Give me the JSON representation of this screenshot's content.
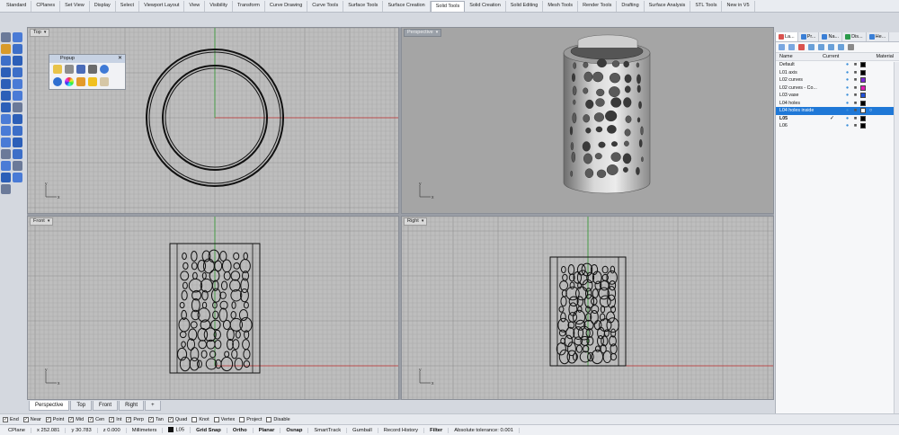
{
  "tabs": [
    "Standard",
    "CPlanes",
    "Set View",
    "Display",
    "Select",
    "Viewport Layout",
    "View",
    "Visibility",
    "Transform",
    "Curve Drawing",
    "Curve Tools",
    "Surface Tools",
    "Surface Creation",
    "Solid Tools",
    "Solid Creation",
    "Solid Editing",
    "Mesh Tools",
    "Render Tools",
    "Drafting",
    "Surface Analysis",
    "STL Tools",
    "New in V5"
  ],
  "active_tab_index": 13,
  "viewports": {
    "top": {
      "title": "Top"
    },
    "perspective": {
      "title": "Perspective"
    },
    "front": {
      "title": "Front"
    },
    "right": {
      "title": "Right"
    }
  },
  "popup": {
    "title": "Popup"
  },
  "viewport_tabs": [
    "Perspective",
    "Top",
    "Front",
    "Right"
  ],
  "osnaps": [
    {
      "label": "End",
      "checked": true
    },
    {
      "label": "Near",
      "checked": true
    },
    {
      "label": "Point",
      "checked": true
    },
    {
      "label": "Mid",
      "checked": true
    },
    {
      "label": "Cen",
      "checked": true
    },
    {
      "label": "Int",
      "checked": true
    },
    {
      "label": "Perp",
      "checked": true
    },
    {
      "label": "Tan",
      "checked": true
    },
    {
      "label": "Quad",
      "checked": true
    },
    {
      "label": "Knot",
      "checked": false
    },
    {
      "label": "Vertex",
      "checked": false
    },
    {
      "label": "Project",
      "checked": false
    },
    {
      "label": "Disable",
      "checked": false
    }
  ],
  "status": {
    "cplane": "CPlane",
    "x": "x 252.081",
    "y": "y 30.783",
    "z": "z 0.000",
    "units": "Millimeters",
    "layer": "L05",
    "grid_snap": "Grid Snap",
    "ortho": "Ortho",
    "planar": "Planar",
    "osnap": "Osnap",
    "smarttrack": "SmartTrack",
    "gumball": "Gumball",
    "record_history": "Record History",
    "filter": "Filter",
    "tolerance": "Absolute tolerance: 0.001"
  },
  "panel": {
    "tabs": [
      "La...",
      "Pr...",
      "Na...",
      "Dis...",
      "He..."
    ],
    "headers": {
      "name": "Name",
      "current": "Current",
      "material": "Material"
    },
    "layers": [
      {
        "name": "Default",
        "current": false,
        "color": "#000000"
      },
      {
        "name": "L01 axis",
        "current": false,
        "color": "#000000"
      },
      {
        "name": "L02 curves",
        "current": false,
        "color": "#7a2ad6"
      },
      {
        "name": "L02 curves - Co...",
        "current": false,
        "color": "#e01eb4"
      },
      {
        "name": "L03 vase",
        "current": false,
        "color": "#2050d8"
      },
      {
        "name": "L04 holes",
        "current": false,
        "color": "#000000"
      },
      {
        "name": "L04 holes inside",
        "current": false,
        "color": "#ffffff",
        "selected": true
      },
      {
        "name": "L05",
        "current": true,
        "color": "#000000",
        "bold": true
      },
      {
        "name": "L06",
        "current": false,
        "color": "#000000"
      }
    ]
  },
  "colors": {
    "accent": "#1f78d7",
    "grid_bg": "#bfbfbf",
    "persp_bg": "#a5a5a5"
  }
}
